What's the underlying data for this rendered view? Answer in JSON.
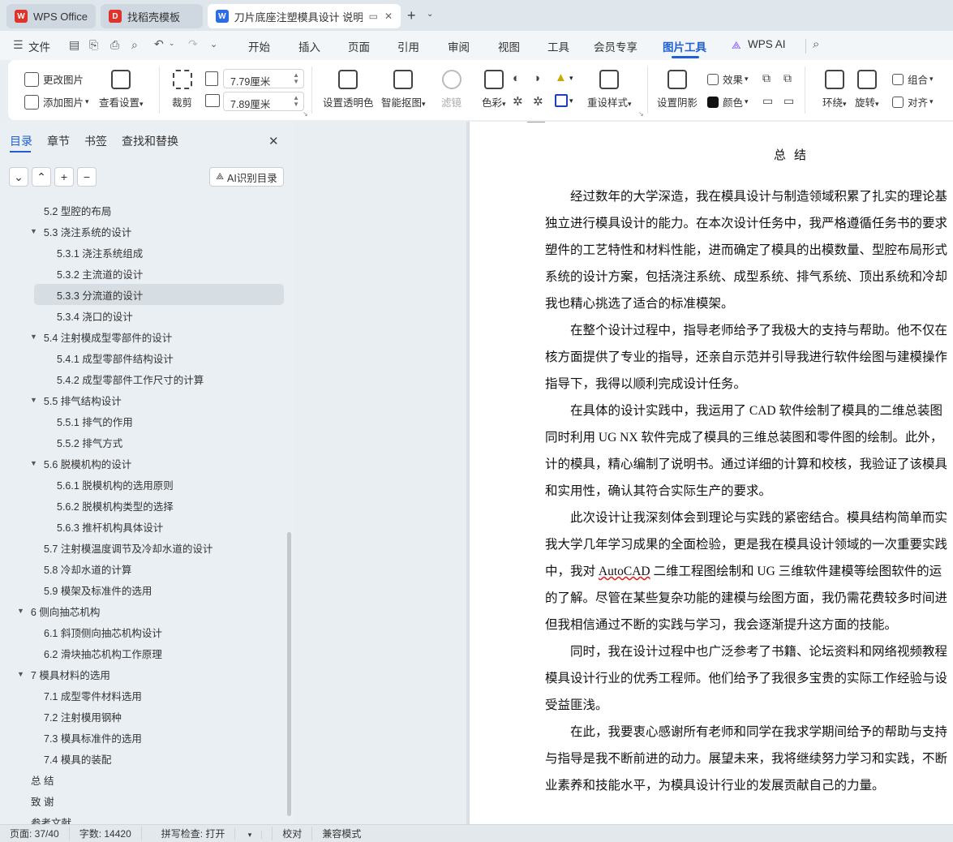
{
  "tabs": [
    {
      "label": "WPS Office",
      "icon": "wps-logo-icon"
    },
    {
      "label": "找稻壳模板",
      "icon": "docer-logo-icon"
    },
    {
      "label": "刀片底座注塑模具设计 说明书",
      "icon": "word-doc-icon"
    }
  ],
  "menu": {
    "file": "文件",
    "tabs": [
      "开始",
      "插入",
      "页面",
      "引用",
      "审阅",
      "视图",
      "工具",
      "会员专享",
      "图片工具",
      "WPS AI"
    ]
  },
  "ribbon": {
    "change_pic": "更改图片",
    "add_pic": "添加图片",
    "view_settings": "查看设置",
    "crop": "裁剪",
    "width": "7.79厘米",
    "height": "7.89厘米",
    "transparent": "设置透明色",
    "smart_cutout": "智能抠图",
    "filter": "滤镜",
    "color": "色彩",
    "reset_style": "重设样式",
    "shadow": "设置阴影",
    "effect": "效果",
    "tint": "颜色",
    "wrap": "环绕",
    "rotate": "旋转",
    "group": "组合",
    "align": "对齐"
  },
  "nav": {
    "tabs": [
      "目录",
      "章节",
      "书签",
      "查找和替换"
    ],
    "ai_button": "AI识别目录",
    "items": [
      {
        "label": "5.2  型腔的布局",
        "level": 2,
        "arrow": ""
      },
      {
        "label": "5.3  浇注系统的设计",
        "level": 2,
        "arrow": "▼"
      },
      {
        "label": "5.3.1  浇注系统组成",
        "level": 3,
        "arrow": ""
      },
      {
        "label": "5.3.2  主流道的设计",
        "level": 3,
        "arrow": ""
      },
      {
        "label": "5.3.3  分流道的设计",
        "level": 3,
        "arrow": "",
        "selected": true
      },
      {
        "label": "5.3.4  浇口的设计",
        "level": 3,
        "arrow": ""
      },
      {
        "label": "5.4  注射模成型零部件的设计",
        "level": 2,
        "arrow": "▼"
      },
      {
        "label": "5.4.1  成型零部件结构设计",
        "level": 3,
        "arrow": ""
      },
      {
        "label": "5.4.2  成型零部件工作尺寸的计算",
        "level": 3,
        "arrow": ""
      },
      {
        "label": "5.5  排气结构设计",
        "level": 2,
        "arrow": "▼"
      },
      {
        "label": "5.5.1 排气的作用",
        "level": 3,
        "arrow": ""
      },
      {
        "label": "5.5.2 排气方式",
        "level": 3,
        "arrow": ""
      },
      {
        "label": "5.6  脱模机构的设计",
        "level": 2,
        "arrow": "▼"
      },
      {
        "label": "5.6.1  脱模机构的选用原则",
        "level": 3,
        "arrow": ""
      },
      {
        "label": "5.6.2  脱模机构类型的选择",
        "level": 3,
        "arrow": ""
      },
      {
        "label": "5.6.3  推杆机构具体设计",
        "level": 3,
        "arrow": ""
      },
      {
        "label": "5.7  注射模温度调节及冷却水道的设计",
        "level": 2,
        "arrow": ""
      },
      {
        "label": "5.8  冷却水道的计算",
        "level": 2,
        "arrow": ""
      },
      {
        "label": "5.9  模架及标准件的选用",
        "level": 2,
        "arrow": ""
      },
      {
        "label": "6  侧向抽芯机构",
        "level": 1,
        "arrow": "▼"
      },
      {
        "label": "6.1  斜顶侧向抽芯机构设计",
        "level": 2,
        "arrow": ""
      },
      {
        "label": "6.2  滑块抽芯机构工作原理",
        "level": 2,
        "arrow": ""
      },
      {
        "label": "7  模具材料的选用",
        "level": 1,
        "arrow": "▼"
      },
      {
        "label": "7.1  成型零件材料选用",
        "level": 2,
        "arrow": ""
      },
      {
        "label": "7.2  注射模用钢种",
        "level": 2,
        "arrow": ""
      },
      {
        "label": "7.3  模具标准件的选用",
        "level": 2,
        "arrow": ""
      },
      {
        "label": "7.4  模具的装配",
        "level": 2,
        "arrow": ""
      },
      {
        "label": "总  结",
        "level": 0,
        "arrow": ""
      },
      {
        "label": "致  谢",
        "level": 0,
        "arrow": ""
      },
      {
        "label": "参考文献",
        "level": 0,
        "arrow": ""
      }
    ]
  },
  "doc": {
    "title": "总结",
    "paragraphs": [
      [
        "　　经过数年的大学深造，我在模具设计与制造领域积累了扎实的理论基",
        "独立进行模具设计的能力。在本次设计任务中，我严格遵循任务书的要求",
        "塑件的工艺特性和材料性能，进而确定了模具的出模数量、型腔布局形式",
        "系统的设计方案，包括浇注系统、成型系统、排气系统、顶出系统和冷却",
        "我也精心挑选了适合的标准模架。"
      ],
      [
        "　　在整个设计过程中，指导老师给予了我极大的支持与帮助。他不仅在",
        "核方面提供了专业的指导，还亲自示范并引导我进行软件绘图与建模操作",
        "指导下，我得以顺利完成设计任务。"
      ],
      [
        "　　在具体的设计实践中，我运用了 CAD 软件绘制了模具的二维总装图",
        "同时利用 UG NX 软件完成了模具的三维总装图和零件图的绘制。此外，",
        "计的模具，精心编制了说明书。通过详细的计算和校核，我验证了该模具",
        "和实用性，确认其符合实际生产的要求。"
      ],
      [
        "　　此次设计让我深刻体会到理论与实践的紧密结合。模具结构简单而实",
        "我大学几年学习成果的全面检验，更是我在模具设计领域的一次重要实践",
        "中，我对 AutoCAD 二维工程图绘制和 UG 三维软件建模等绘图软件的运",
        "的了解。尽管在某些复杂功能的建模与绘图方面，我仍需花费较多时间进",
        "但我相信通过不断的实践与学习，我会逐渐提升这方面的技能。"
      ],
      [
        "　　同时，我在设计过程中也广泛参考了书籍、论坛资料和网络视频教程",
        "模具设计行业的优秀工程师。他们给予了我很多宝贵的实际工作经验与设",
        "受益匪浅。"
      ],
      [
        "　　在此，我要衷心感谢所有老师和同学在我求学期间给予的帮助与支持",
        "与指导是我不断前进的动力。展望未来，我将继续努力学习和实践，不断",
        "业素养和技能水平，为模具设计行业的发展贡献自己的力量。"
      ]
    ]
  },
  "status": {
    "page": "页面: 37/40",
    "words": "字数: 14420",
    "spell": "拼写检查: 打开",
    "proof": "校对",
    "compat": "兼容模式"
  },
  "colors": {
    "accent": "#1f5fd1",
    "wps_red": "#e0322b",
    "docer_red": "#e0322b",
    "word_blue": "#2b6be6"
  }
}
